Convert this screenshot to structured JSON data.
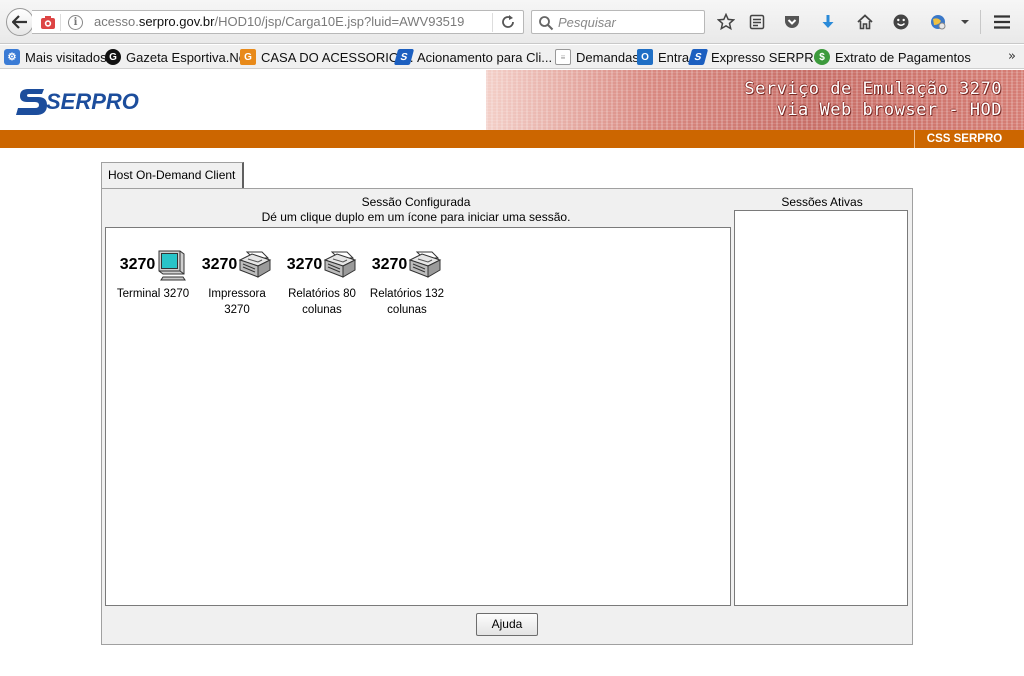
{
  "browser": {
    "url_prefix": "acesso.",
    "url_domain": "serpro.gov.br",
    "url_path": "/HOD10/jsp/Carga10E.jsp?luid=AWV93519",
    "search_placeholder": "Pesquisar"
  },
  "bookmarks": [
    {
      "label": "Mais visitados",
      "icon": "gear-bookmark-icon",
      "color": "#3a7bd5"
    },
    {
      "label": "Gazeta Esportiva.Net",
      "icon": "gazeta-icon",
      "icon_text": "G",
      "color": "#111111"
    },
    {
      "label": "CASA DO ACESSORIO ...",
      "icon": "casa-icon",
      "icon_text": "G",
      "color": "#e88a1a"
    },
    {
      "label": "Acionamento para Cli...",
      "icon": "serpro-icon",
      "color": "#1c5fc0"
    },
    {
      "label": "Demandas",
      "icon": "page-icon",
      "color": "#999999"
    },
    {
      "label": "Entra",
      "icon": "outlook-icon",
      "icon_text": "O",
      "color": "#1f6fc5"
    },
    {
      "label": "Expresso SERPRO",
      "icon": "serpro-icon",
      "color": "#1c5fc0"
    },
    {
      "label": "Extrato de Pagamentos",
      "icon": "money-icon",
      "color": "#3c9a3c"
    }
  ],
  "header": {
    "logo_text": "SERPRO",
    "banner_line1": "Serviço de Emulação 3270",
    "banner_line2": "via Web browser - HOD",
    "css_label": "CSS SERPRO"
  },
  "applet": {
    "tab_label": "Host On-Demand Client",
    "configured_title": "Sessão Configurada",
    "configured_hint": "Dé um clique duplo em um ícone para iniciar uma sessão.",
    "active_title": "Sessões Ativas",
    "help_label": "Ajuda",
    "sessions": [
      {
        "badge": "3270",
        "label": "Terminal 3270",
        "icon": "terminal-icon"
      },
      {
        "badge": "3270",
        "label": "Impressora\n3270",
        "icon": "printer-icon"
      },
      {
        "badge": "3270",
        "label": "Relatórios 80\ncolunas",
        "icon": "printer-icon"
      },
      {
        "badge": "3270",
        "label": "Relatórios 132\ncolunas",
        "icon": "printer-icon"
      }
    ]
  }
}
